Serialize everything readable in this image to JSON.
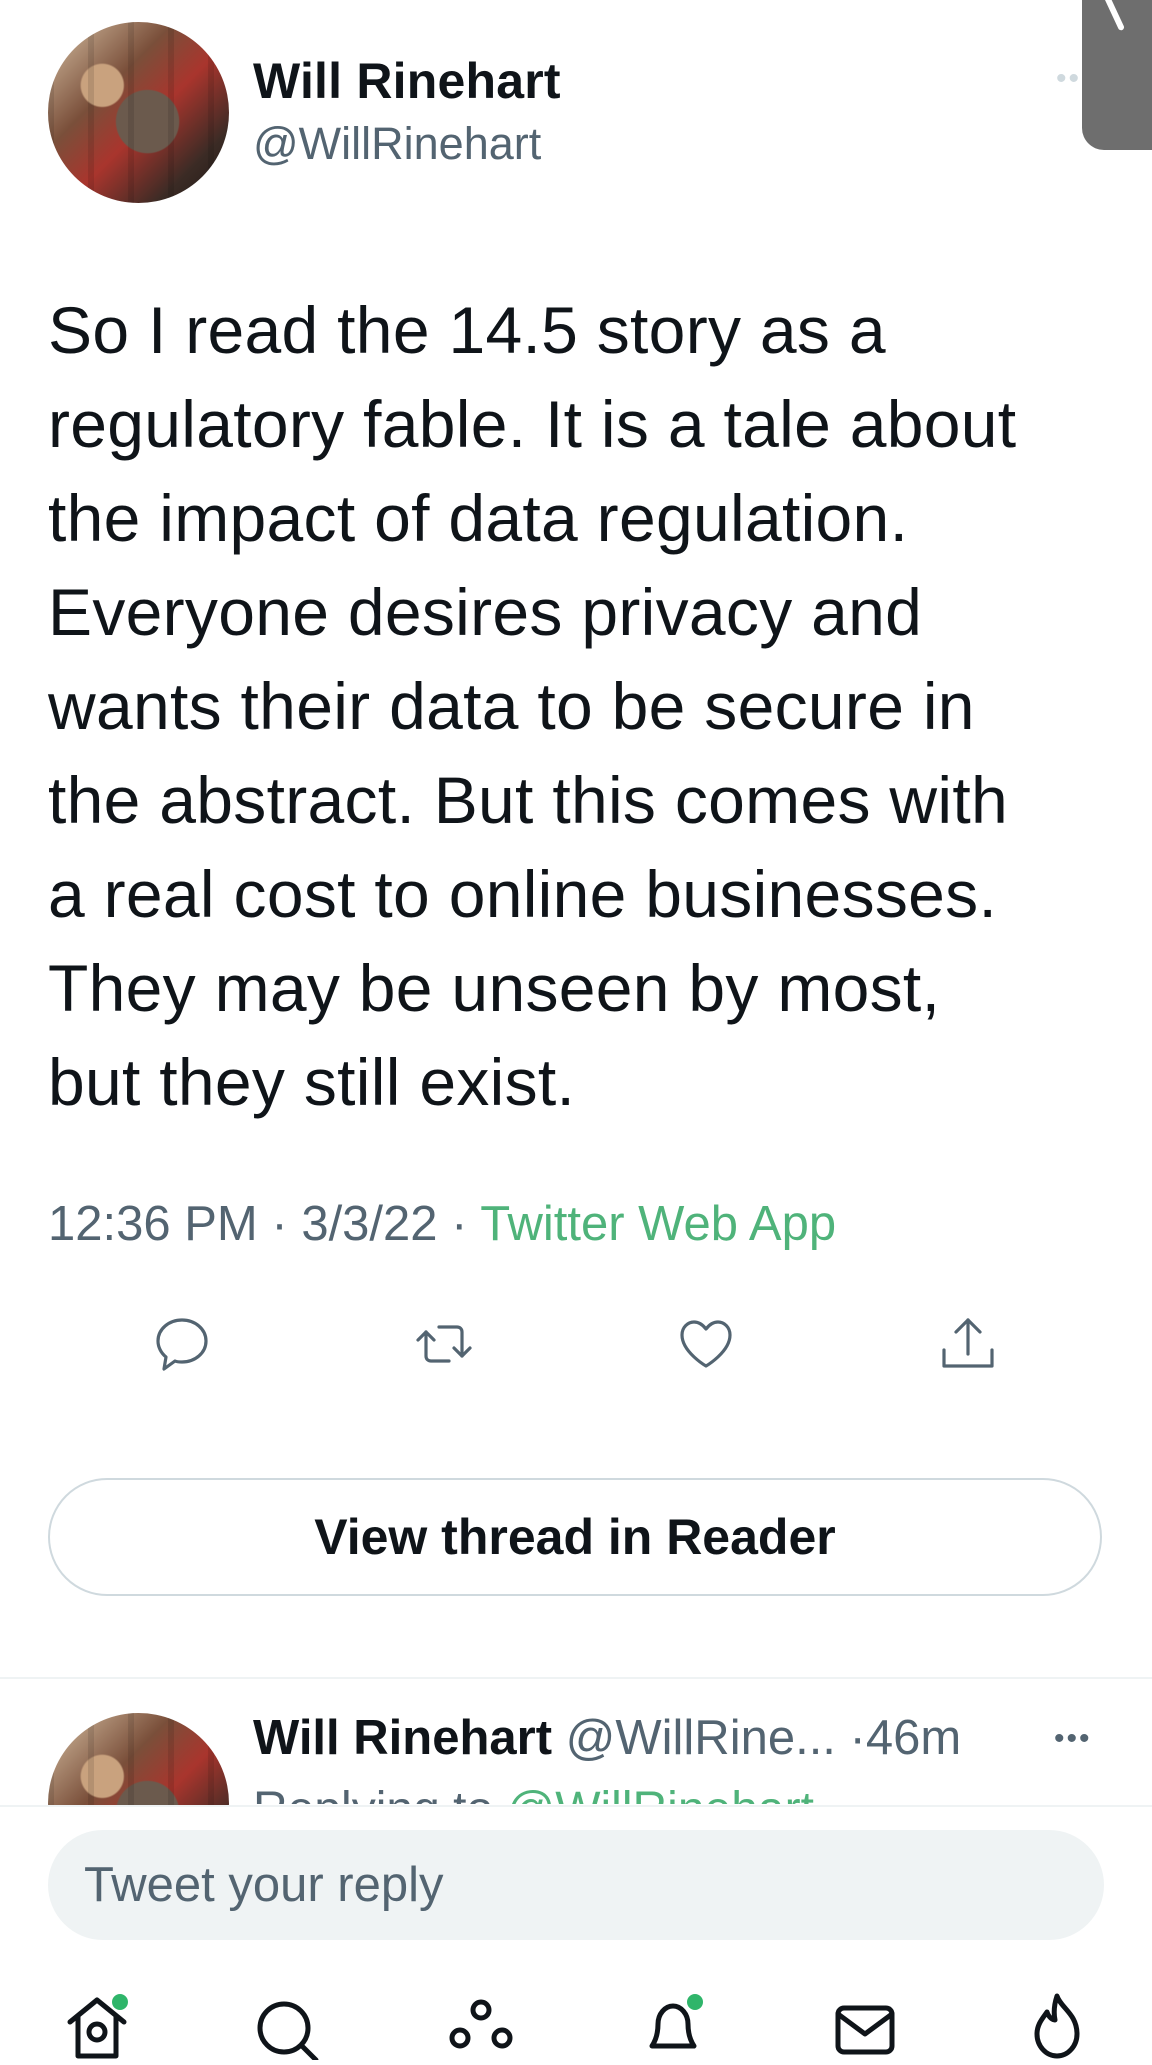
{
  "tweet": {
    "author_name": "Will Rinehart",
    "author_handle": "@WillRinehart",
    "text": "So I read the 14.5 story as a\nregulatory fable. It is a tale about\nthe impact of data regulation.\nEveryone desires privacy and\nwants their data to be secure in\nthe abstract. But this comes with\na real cost to online businesses.\nThey may be unseen by most,\nbut they still exist.",
    "time": "12:36 PM",
    "date": "3/3/22",
    "separator": "·",
    "source": "Twitter Web App",
    "more_icon": "more-dots-icon"
  },
  "actions": {
    "reply_icon": "reply-icon",
    "retweet_icon": "retweet-icon",
    "like_icon": "heart-icon",
    "share_icon": "share-icon"
  },
  "reader_button": {
    "label": "View thread in Reader"
  },
  "next_reply": {
    "author_name": "Will Rinehart",
    "author_handle": "@WillRine...",
    "separator": "·",
    "age": "46m",
    "more": "•••",
    "replying_prefix": "Replying to ",
    "replying_handle": "@WillRinehart"
  },
  "composer": {
    "placeholder": "Tweet your reply"
  },
  "bottom_nav": {
    "items": [
      "home-icon",
      "search-icon",
      "spaces-icon",
      "notifications-icon",
      "messages-icon",
      "trending-icon"
    ],
    "badge_color": "#2fb56a"
  },
  "colors": {
    "accent_source": "#4fb37a",
    "secondary_text": "#536471",
    "primary_text": "#0f1419"
  }
}
